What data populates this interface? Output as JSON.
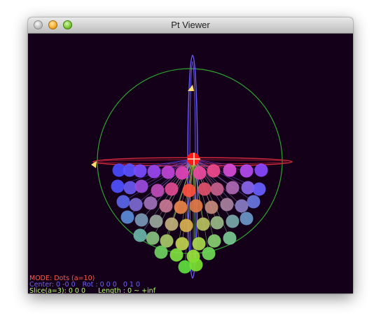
{
  "window": {
    "title": "Pt Viewer",
    "buttons": [
      "close",
      "minimize",
      "zoom"
    ]
  },
  "status": {
    "mode": "MODE: Dots (a=10)",
    "center": "Center: 0 -0 0",
    "rot": "Rot : 0 0 0   0 1 0",
    "slice": "Slice(a=3): 0 0 0",
    "length": "Length : 0 ~ +inf"
  },
  "colors": {
    "background": "#15001a",
    "sphere_outline": "#2ea32e",
    "vertical_axis": "#6a5cff",
    "horizontal_axis": "#d2283c",
    "origin": "#ff2020",
    "marker": "#ffe070"
  }
}
